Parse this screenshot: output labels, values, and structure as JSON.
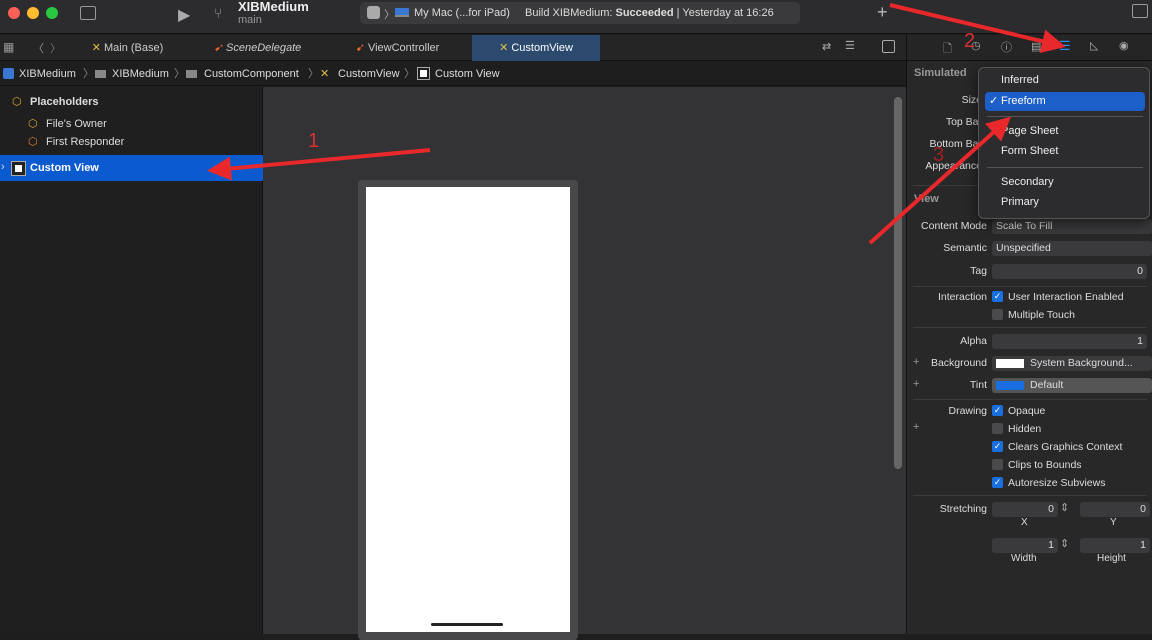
{
  "titlebar": {
    "project": "XIBMedium",
    "branch": "main",
    "destination": "My Mac (...for iPad)",
    "status_prefix": "Build XIBMedium:",
    "status_result": "Succeeded",
    "status_time": "| Yesterday at 16:26"
  },
  "tabs": [
    {
      "label": "Main (Base)"
    },
    {
      "label": "SceneDelegate"
    },
    {
      "label": "ViewController"
    },
    {
      "label": "CustomView"
    }
  ],
  "breadcrumb": [
    "XIBMedium",
    "XIBMedium",
    "CustomComponent",
    "CustomView",
    "Custom View"
  ],
  "navigator": {
    "placeholders": "Placeholders",
    "files_owner": "File's Owner",
    "first_responder": "First Responder",
    "custom_view": "Custom View"
  },
  "annotations": {
    "n1": "1",
    "n2": "2",
    "n3": "3"
  },
  "inspector": {
    "simulated": "Simulated",
    "size": "Size",
    "top_bar": "Top Bar",
    "bottom_bar": "Bottom Bar",
    "appearance": "Appearance",
    "view": "View",
    "content_mode_label": "Content Mode",
    "content_mode": "Scale To Fill",
    "semantic_label": "Semantic",
    "semantic": "Unspecified",
    "tag_label": "Tag",
    "tag": "0",
    "interaction_label": "Interaction",
    "user_interaction": "User Interaction Enabled",
    "multiple_touch": "Multiple Touch",
    "alpha_label": "Alpha",
    "alpha": "1",
    "background_label": "Background",
    "background": "System Background...",
    "tint_label": "Tint",
    "tint": "Default",
    "drawing_label": "Drawing",
    "opaque": "Opaque",
    "hidden": "Hidden",
    "clears": "Clears Graphics Context",
    "clips": "Clips to Bounds",
    "autoresize": "Autoresize Subviews",
    "stretching_label": "Stretching",
    "x": "0",
    "y": "0",
    "x_label": "X",
    "y_label": "Y",
    "width": "1",
    "height": "1",
    "width_label": "Width",
    "height_label": "Height"
  },
  "menu": {
    "items": [
      "Inferred",
      "Freeform",
      "Page Sheet",
      "Form Sheet",
      "Secondary",
      "Primary"
    ],
    "check": "✓"
  },
  "colors": {
    "accent": "#1a6fe0",
    "arrow": "#e8282b"
  }
}
